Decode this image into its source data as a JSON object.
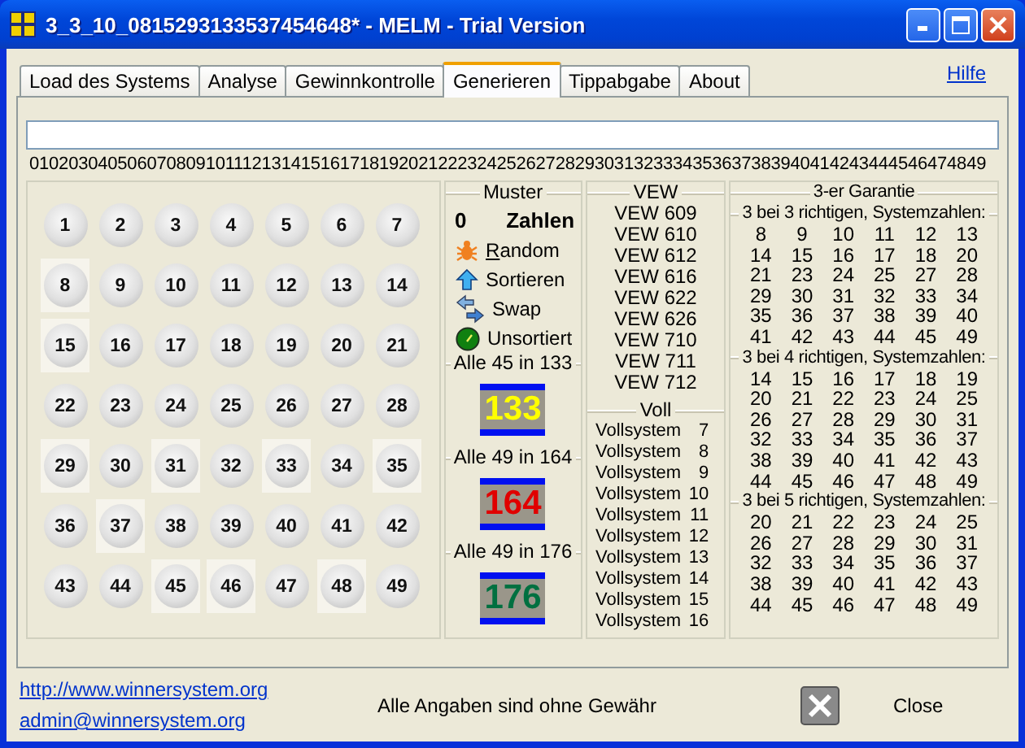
{
  "window": {
    "title": "3_3_10_0815293133537454648* - MELM - Trial Version"
  },
  "tabs": [
    {
      "label": "Load des Systems",
      "selected": false
    },
    {
      "label": "Analyse",
      "selected": false
    },
    {
      "label": "Gewinnkontrolle",
      "selected": false
    },
    {
      "label": "Generieren",
      "selected": true
    },
    {
      "label": "Tippabgabe",
      "selected": false
    },
    {
      "label": "About",
      "selected": false
    }
  ],
  "help_link": "Hilfe",
  "digits": "01020304050607080910111213141516171819202122232425262728293031323334353637383940414243444546474849",
  "balls": [
    {
      "label": "1",
      "selected": false
    },
    {
      "label": "2",
      "selected": false
    },
    {
      "label": "3",
      "selected": false
    },
    {
      "label": "4",
      "selected": false
    },
    {
      "label": "5",
      "selected": false
    },
    {
      "label": "6",
      "selected": false
    },
    {
      "label": "7",
      "selected": false
    },
    {
      "label": "8",
      "selected": true
    },
    {
      "label": "9",
      "selected": false
    },
    {
      "label": "10",
      "selected": false
    },
    {
      "label": "11",
      "selected": false
    },
    {
      "label": "12",
      "selected": false
    },
    {
      "label": "13",
      "selected": false
    },
    {
      "label": "14",
      "selected": false
    },
    {
      "label": "15",
      "selected": true
    },
    {
      "label": "16",
      "selected": false
    },
    {
      "label": "17",
      "selected": false
    },
    {
      "label": "18",
      "selected": false
    },
    {
      "label": "19",
      "selected": false
    },
    {
      "label": "20",
      "selected": false
    },
    {
      "label": "21",
      "selected": false
    },
    {
      "label": "22",
      "selected": false
    },
    {
      "label": "23",
      "selected": false
    },
    {
      "label": "24",
      "selected": false
    },
    {
      "label": "25",
      "selected": false
    },
    {
      "label": "26",
      "selected": false
    },
    {
      "label": "27",
      "selected": false
    },
    {
      "label": "28",
      "selected": false
    },
    {
      "label": "29",
      "selected": true
    },
    {
      "label": "30",
      "selected": false
    },
    {
      "label": "31",
      "selected": true
    },
    {
      "label": "32",
      "selected": false
    },
    {
      "label": "33",
      "selected": true
    },
    {
      "label": "34",
      "selected": false
    },
    {
      "label": "35",
      "selected": true
    },
    {
      "label": "36",
      "selected": false
    },
    {
      "label": "37",
      "selected": true
    },
    {
      "label": "38",
      "selected": false
    },
    {
      "label": "39",
      "selected": false
    },
    {
      "label": "40",
      "selected": false
    },
    {
      "label": "41",
      "selected": false
    },
    {
      "label": "42",
      "selected": false
    },
    {
      "label": "43",
      "selected": false
    },
    {
      "label": "44",
      "selected": false
    },
    {
      "label": "45",
      "selected": true
    },
    {
      "label": "46",
      "selected": true
    },
    {
      "label": "47",
      "selected": false
    },
    {
      "label": "48",
      "selected": true
    },
    {
      "label": "49",
      "selected": false
    }
  ],
  "muster": {
    "title": "Muster",
    "count": "0",
    "count_label": "Zahlen",
    "actions": [
      {
        "kind": "random",
        "label": "Random",
        "mnemonic": true
      },
      {
        "kind": "sort",
        "label": "Sortieren",
        "mnemonic": false
      },
      {
        "kind": "swap",
        "label": "Swap",
        "mnemonic": false
      },
      {
        "kind": "unsorted",
        "label": "Unsortiert",
        "mnemonic": false
      }
    ],
    "systems": [
      {
        "label": "Alle 45 in 133",
        "value": "133",
        "color": "#ffff00"
      },
      {
        "label": "Alle 49 in 164",
        "value": "164",
        "color": "#e00000"
      },
      {
        "label": "Alle 49 in 176",
        "value": "176",
        "color": "#007040"
      }
    ]
  },
  "vew": {
    "title": "VEW",
    "items": [
      "VEW 609",
      "VEW 610",
      "VEW 612",
      "VEW 616",
      "VEW 622",
      "VEW 626",
      "VEW 710",
      "VEW 711",
      "VEW 712"
    ]
  },
  "voll": {
    "title": "Voll",
    "items": [
      {
        "label": "Vollsystem",
        "number": "7"
      },
      {
        "label": "Vollsystem",
        "number": "8"
      },
      {
        "label": "Vollsystem",
        "number": "9"
      },
      {
        "label": "Vollsystem",
        "number": "10"
      },
      {
        "label": "Vollsystem",
        "number": "11"
      },
      {
        "label": "Vollsystem",
        "number": "12"
      },
      {
        "label": "Vollsystem",
        "number": "13"
      },
      {
        "label": "Vollsystem",
        "number": "14"
      },
      {
        "label": "Vollsystem",
        "number": "15"
      },
      {
        "label": "Vollsystem",
        "number": "16"
      }
    ]
  },
  "garantie": {
    "title": "3-er Garantie",
    "sections": [
      {
        "title": "3 bei 3 richtigen, Systemzahlen:",
        "numbers": [
          "8",
          "9",
          "10",
          "11",
          "12",
          "13",
          "14",
          "15",
          "16",
          "17",
          "18",
          "20",
          "21",
          "23",
          "24",
          "25",
          "27",
          "28",
          "29",
          "30",
          "31",
          "32",
          "33",
          "34",
          "35",
          "36",
          "37",
          "38",
          "39",
          "40",
          "41",
          "42",
          "43",
          "44",
          "45",
          "49"
        ]
      },
      {
        "title": "3 bei 4 richtigen, Systemzahlen:",
        "numbers": [
          "14",
          "15",
          "16",
          "17",
          "18",
          "19",
          "20",
          "21",
          "22",
          "23",
          "24",
          "25",
          "26",
          "27",
          "28",
          "29",
          "30",
          "31",
          "32",
          "33",
          "34",
          "35",
          "36",
          "37",
          "38",
          "39",
          "40",
          "41",
          "42",
          "43",
          "44",
          "45",
          "46",
          "47",
          "48",
          "49"
        ]
      },
      {
        "title": "3 bei 5 richtigen, Systemzahlen:",
        "numbers": [
          "20",
          "21",
          "22",
          "23",
          "24",
          "25",
          "26",
          "27",
          "28",
          "29",
          "30",
          "31",
          "32",
          "33",
          "34",
          "35",
          "36",
          "37",
          "38",
          "39",
          "40",
          "41",
          "42",
          "43",
          "44",
          "45",
          "46",
          "47",
          "48",
          "49"
        ]
      }
    ]
  },
  "footer": {
    "links": [
      "http://www.winnersystem.org",
      "admin@winnersystem.org"
    ],
    "disclaimer": "Alle Angaben sind ohne Gewähr",
    "close": "Close"
  }
}
